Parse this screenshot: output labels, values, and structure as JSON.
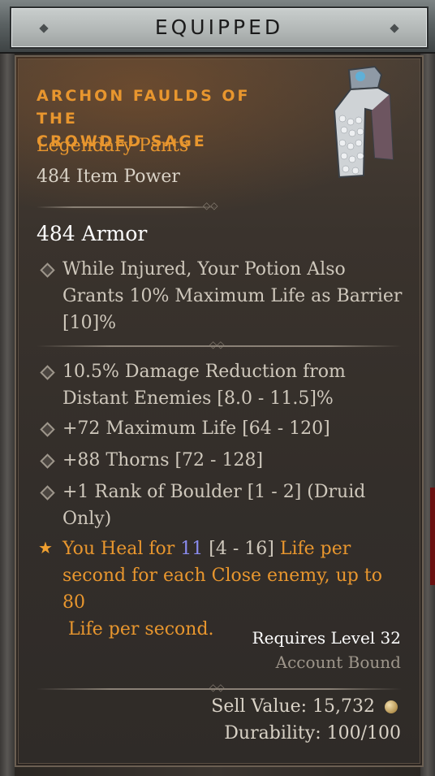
{
  "header": {
    "title": "EQUIPPED"
  },
  "item": {
    "name_line1": "ARCHON FAULDS OF THE",
    "name_line2": "CROWDED SAGE",
    "type": "Legendary Pants",
    "power": "484 Item Power",
    "armor": "484 Armor",
    "icon": "pants-icon"
  },
  "stats": [
    {
      "line1": "While Injured, Your Potion Also",
      "line2": "Grants 10% Maximum Life as Barrier",
      "line3": "[10]%"
    },
    {
      "line1": "10.5% Damage Reduction from",
      "line2": "Distant Enemies [8.0 - 11.5]%"
    },
    {
      "line1": "+72 Maximum Life [64 - 120]"
    },
    {
      "line1": "+88 Thorns [72 - 128]"
    },
    {
      "line1": "+1 Rank of Boulder [1 - 2] (Druid",
      "line2": "Only)"
    }
  ],
  "legendary": {
    "prefix": "You Heal for ",
    "value": "11",
    "range": " [4 - 16] ",
    "suffix1": "Life per",
    "line2": "second for each Close enemy, up to 80",
    "line3": " Life per second."
  },
  "footer": {
    "requires": "Requires Level 32",
    "bound": "Account Bound",
    "sell": "Sell Value: 15,732",
    "durability": "Durability: 100/100"
  },
  "colors": {
    "legendary": "#e8962e",
    "highlight": "#8a8cf0",
    "stat": "#cfc8bc"
  }
}
